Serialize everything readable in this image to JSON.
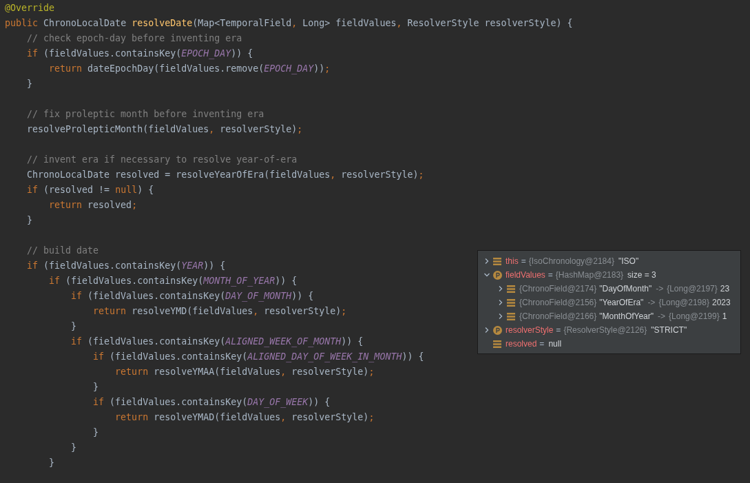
{
  "editor": {
    "lines": [
      {
        "kind": "code",
        "tokens": [
          {
            "kind": "annotation",
            "text": "@Override"
          }
        ]
      },
      {
        "kind": "code",
        "tokens": [
          {
            "kind": "keyword",
            "text": "public"
          },
          {
            "kind": "plain",
            "text": " ChronoLocalDate "
          },
          {
            "kind": "decl",
            "text": "resolveDate"
          },
          {
            "kind": "plain",
            "text": "(Map<TemporalField"
          },
          {
            "kind": "keyword",
            "text": ","
          },
          {
            "kind": "plain",
            "text": " Long> fieldValues"
          },
          {
            "kind": "keyword",
            "text": ","
          },
          {
            "kind": "plain",
            "text": " ResolverStyle resolverStyle) {"
          }
        ]
      },
      {
        "kind": "code",
        "tokens": [
          {
            "kind": "comment",
            "text": "    // check epoch-day before inventing era"
          }
        ]
      },
      {
        "kind": "code",
        "tokens": [
          {
            "kind": "keyword",
            "text": "    if"
          },
          {
            "kind": "plain",
            "text": " (fieldValues.containsKey("
          },
          {
            "kind": "constant",
            "text": "EPOCH_DAY"
          },
          {
            "kind": "plain",
            "text": ")) {"
          }
        ]
      },
      {
        "kind": "code",
        "tokens": [
          {
            "kind": "keyword",
            "text": "        return"
          },
          {
            "kind": "plain",
            "text": " dateEpochDay(fieldValues.remove("
          },
          {
            "kind": "constant",
            "text": "EPOCH_DAY"
          },
          {
            "kind": "plain",
            "text": "))"
          },
          {
            "kind": "keyword",
            "text": ";"
          }
        ]
      },
      {
        "kind": "code",
        "tokens": [
          {
            "kind": "plain",
            "text": "    }"
          }
        ]
      },
      {
        "kind": "blank"
      },
      {
        "kind": "code",
        "tokens": [
          {
            "kind": "comment",
            "text": "    // fix proleptic month before inventing era"
          }
        ]
      },
      {
        "kind": "code",
        "tokens": [
          {
            "kind": "plain",
            "text": "    resolveProlepticMonth(fieldValues"
          },
          {
            "kind": "keyword",
            "text": ","
          },
          {
            "kind": "plain",
            "text": " resolverStyle)"
          },
          {
            "kind": "keyword",
            "text": ";"
          }
        ]
      },
      {
        "kind": "blank"
      },
      {
        "kind": "code",
        "tokens": [
          {
            "kind": "comment",
            "text": "    // invent era if necessary to resolve year-of-era"
          }
        ]
      },
      {
        "kind": "code",
        "tokens": [
          {
            "kind": "plain",
            "text": "    ChronoLocalDate resolved = resolveYearOfEra(fieldValues"
          },
          {
            "kind": "keyword",
            "text": ","
          },
          {
            "kind": "plain",
            "text": " resolverStyle)"
          },
          {
            "kind": "keyword",
            "text": ";"
          }
        ]
      },
      {
        "kind": "code",
        "tokens": [
          {
            "kind": "keyword",
            "text": "    if"
          },
          {
            "kind": "plain",
            "text": " (resolved != "
          },
          {
            "kind": "keyword",
            "text": "null"
          },
          {
            "kind": "plain",
            "text": ") {"
          }
        ]
      },
      {
        "kind": "code",
        "tokens": [
          {
            "kind": "keyword",
            "text": "        return"
          },
          {
            "kind": "plain",
            "text": " resolved"
          },
          {
            "kind": "keyword",
            "text": ";"
          }
        ]
      },
      {
        "kind": "code",
        "tokens": [
          {
            "kind": "plain",
            "text": "    }"
          }
        ]
      },
      {
        "kind": "blank"
      },
      {
        "kind": "code",
        "tokens": [
          {
            "kind": "comment",
            "text": "    // build date"
          }
        ]
      },
      {
        "kind": "code",
        "tokens": [
          {
            "kind": "keyword",
            "text": "    if"
          },
          {
            "kind": "plain",
            "text": " (fieldValues.containsKey("
          },
          {
            "kind": "constant",
            "text": "YEAR"
          },
          {
            "kind": "plain",
            "text": ")) {"
          }
        ]
      },
      {
        "kind": "code",
        "tokens": [
          {
            "kind": "keyword",
            "text": "        if"
          },
          {
            "kind": "plain",
            "text": " (fieldValues.containsKey("
          },
          {
            "kind": "constant",
            "text": "MONTH_OF_YEAR"
          },
          {
            "kind": "plain",
            "text": ")) {"
          }
        ]
      },
      {
        "kind": "code",
        "tokens": [
          {
            "kind": "keyword",
            "text": "            if"
          },
          {
            "kind": "plain",
            "text": " (fieldValues.containsKey("
          },
          {
            "kind": "constant",
            "text": "DAY_OF_MONTH"
          },
          {
            "kind": "plain",
            "text": ")) {"
          }
        ]
      },
      {
        "kind": "code",
        "tokens": [
          {
            "kind": "keyword",
            "text": "                return"
          },
          {
            "kind": "plain",
            "text": " resolveYMD(fieldValues"
          },
          {
            "kind": "keyword",
            "text": ","
          },
          {
            "kind": "plain",
            "text": " resolverStyle)"
          },
          {
            "kind": "keyword",
            "text": ";"
          }
        ]
      },
      {
        "kind": "code",
        "tokens": [
          {
            "kind": "plain",
            "text": "            }"
          }
        ]
      },
      {
        "kind": "code",
        "tokens": [
          {
            "kind": "keyword",
            "text": "            if"
          },
          {
            "kind": "plain",
            "text": " (fieldValues.containsKey("
          },
          {
            "kind": "constant",
            "text": "ALIGNED_WEEK_OF_MONTH"
          },
          {
            "kind": "plain",
            "text": ")) {"
          }
        ]
      },
      {
        "kind": "code",
        "tokens": [
          {
            "kind": "keyword",
            "text": "                if"
          },
          {
            "kind": "plain",
            "text": " (fieldValues.containsKey("
          },
          {
            "kind": "constant",
            "text": "ALIGNED_DAY_OF_WEEK_IN_MONTH"
          },
          {
            "kind": "plain",
            "text": ")) {"
          }
        ]
      },
      {
        "kind": "code",
        "tokens": [
          {
            "kind": "keyword",
            "text": "                    return"
          },
          {
            "kind": "plain",
            "text": " resolveYMAA(fieldValues"
          },
          {
            "kind": "keyword",
            "text": ","
          },
          {
            "kind": "plain",
            "text": " resolverStyle)"
          },
          {
            "kind": "keyword",
            "text": ";"
          }
        ]
      },
      {
        "kind": "code",
        "tokens": [
          {
            "kind": "plain",
            "text": "                }"
          }
        ]
      },
      {
        "kind": "code",
        "tokens": [
          {
            "kind": "keyword",
            "text": "                if"
          },
          {
            "kind": "plain",
            "text": " (fieldValues.containsKey("
          },
          {
            "kind": "constant",
            "text": "DAY_OF_WEEK"
          },
          {
            "kind": "plain",
            "text": ")) {"
          }
        ]
      },
      {
        "kind": "code",
        "tokens": [
          {
            "kind": "keyword",
            "text": "                    return"
          },
          {
            "kind": "plain",
            "text": " resolveYMAD(fieldValues"
          },
          {
            "kind": "keyword",
            "text": ","
          },
          {
            "kind": "plain",
            "text": " resolverStyle)"
          },
          {
            "kind": "keyword",
            "text": ";"
          }
        ]
      },
      {
        "kind": "code",
        "tokens": [
          {
            "kind": "plain",
            "text": "                }"
          }
        ]
      },
      {
        "kind": "code",
        "tokens": [
          {
            "kind": "plain",
            "text": "            }"
          }
        ]
      },
      {
        "kind": "code",
        "tokens": [
          {
            "kind": "plain",
            "text": "        }"
          }
        ]
      }
    ]
  },
  "debugger": {
    "variables": [
      {
        "kind": "field",
        "expanded": false,
        "name": "this",
        "sign": "=",
        "type": "{IsoChronology@2184}",
        "value": "\"ISO\""
      },
      {
        "kind": "param",
        "expanded": true,
        "name": "fieldValues",
        "sign": "=",
        "type": "{HashMap@2183}",
        "value": "size = 3",
        "children": [
          {
            "kind": "field",
            "expanded": false,
            "key_type": "{ChronoField@2174}",
            "key": "\"DayOfMonth\"",
            "arrow": "->",
            "value_type": "{Long@2197}",
            "value": "23"
          },
          {
            "kind": "field",
            "expanded": false,
            "key_type": "{ChronoField@2156}",
            "key": "\"YearOfEra\"",
            "arrow": "->",
            "value_type": "{Long@2198}",
            "value": "2023"
          },
          {
            "kind": "field",
            "expanded": false,
            "key_type": "{ChronoField@2166}",
            "key": "\"MonthOfYear\"",
            "arrow": "->",
            "value_type": "{Long@2199}",
            "value": "1"
          }
        ]
      },
      {
        "kind": "param",
        "expanded": false,
        "name": "resolverStyle",
        "sign": "=",
        "type": "{ResolverStyle@2126}",
        "value": "\"STRICT\""
      },
      {
        "kind": "field",
        "name": "resolved",
        "sign": "=",
        "value": "null"
      }
    ]
  }
}
